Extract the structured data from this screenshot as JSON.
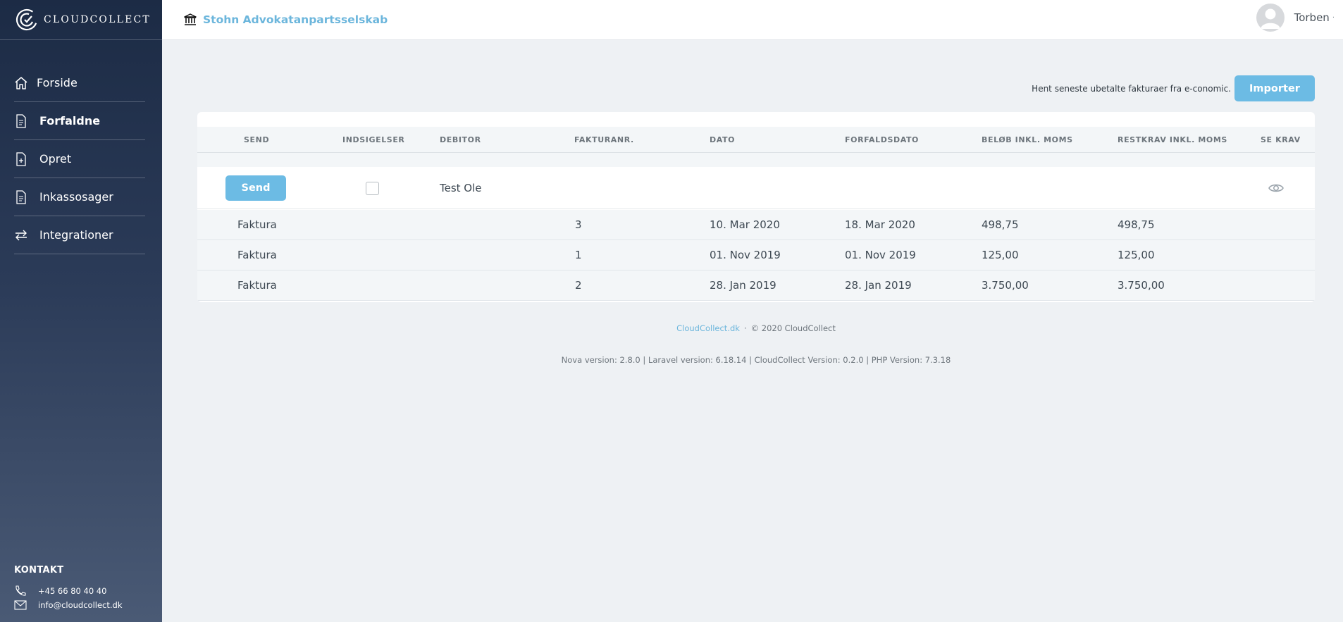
{
  "brand": {
    "name": "CLOUDCOLLECT"
  },
  "sidebar": {
    "items": [
      {
        "label": "Forside",
        "icon": "home-icon"
      },
      {
        "label": "Forfaldne",
        "icon": "document-icon"
      },
      {
        "label": "Opret",
        "icon": "add-document-icon"
      },
      {
        "label": "Inkassosager",
        "icon": "document-icon"
      },
      {
        "label": "Integrationer",
        "icon": "exchange-icon"
      }
    ],
    "active": "Forfaldne",
    "contact": {
      "title": "KONTAKT",
      "phone": "+45 66 80 40 40",
      "email": "info@cloudcollect.dk"
    }
  },
  "header": {
    "company": "Stohn Advokatanpartsselskab",
    "user": "Torben"
  },
  "main": {
    "import_text": "Hent seneste ubetalte fakturaer fra e-conomic.",
    "import_label": "Importer",
    "columns": [
      "SEND",
      "INDSIGELSER",
      "DEBITOR",
      "FAKTURANR.",
      "DATO",
      "FORFALDSDATO",
      "BELØB INKL. MOMS",
      "RESTKRAV INKL. MOMS",
      "SE KRAV"
    ],
    "group": {
      "send_label": "Send",
      "debtor": "Test Ole",
      "objection_checked": false
    },
    "rows": [
      {
        "type": "Faktura",
        "number": "3",
        "date": "10. Mar 2020",
        "due": "18. Mar 2020",
        "amount": "498,75",
        "remaining": "498,75"
      },
      {
        "type": "Faktura",
        "number": "1",
        "date": "01. Nov 2019",
        "due": "01. Nov 2019",
        "amount": "125,00",
        "remaining": "125,00"
      },
      {
        "type": "Faktura",
        "number": "2",
        "date": "28. Jan 2019",
        "due": "28. Jan 2019",
        "amount": "3.750,00",
        "remaining": "3.750,00"
      }
    ]
  },
  "footer": {
    "link": "CloudCollect.dk",
    "separator": "·",
    "copyright": "© 2020 CloudCollect",
    "versions": "Nova version: 2.8.0 | Laravel version: 6.18.14 | CloudCollect Version: 0.2.0 | PHP Version: 7.3.18"
  },
  "colors": {
    "accent": "#6cbbe4",
    "sidebar_top": "#1c2b45",
    "sidebar_bottom": "#4a5a75",
    "background": "#eef1f4"
  }
}
